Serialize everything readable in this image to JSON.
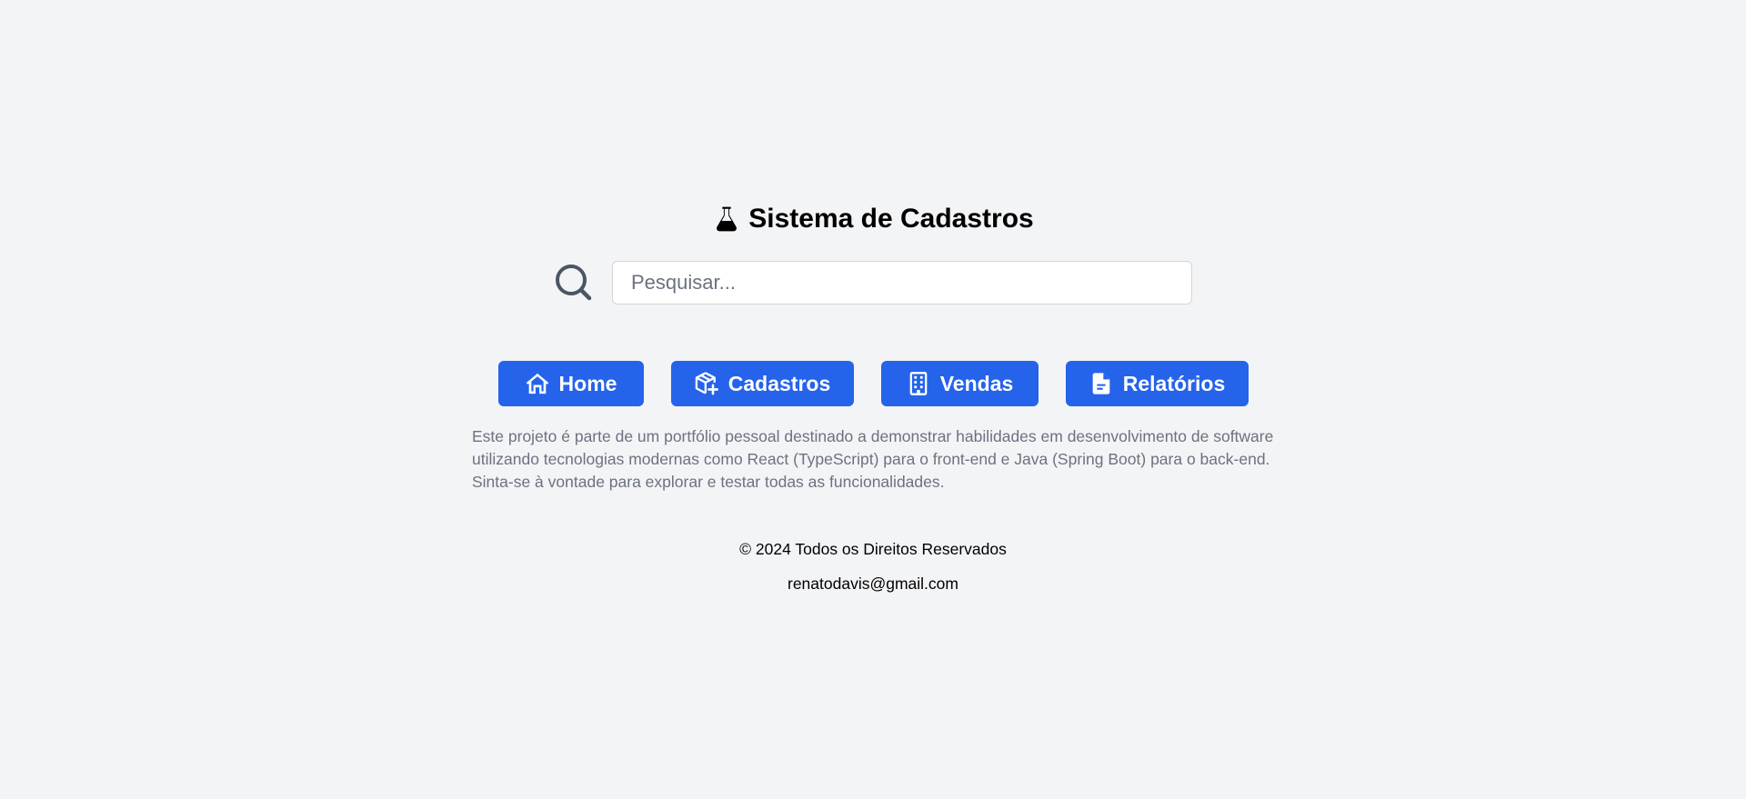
{
  "header": {
    "title": "Sistema de Cadastros",
    "icon": "flask-icon"
  },
  "search": {
    "icon": "search-icon",
    "placeholder": "Pesquisar...",
    "value": ""
  },
  "nav": {
    "home": {
      "label": "Home",
      "icon": "home-icon"
    },
    "cadastros": {
      "label": "Cadastros",
      "icon": "box-plus-icon"
    },
    "vendas": {
      "label": "Vendas",
      "icon": "building-icon"
    },
    "relatorios": {
      "label": "Relatórios",
      "icon": "document-icon"
    }
  },
  "description": {
    "line1": "Este projeto é parte de um portfólio pessoal destinado a demonstrar habilidades em desenvolvimento de software",
    "line2": "utilizando tecnologias modernas como React (TypeScript) para o front-end e Java (Spring Boot) para o back-end.",
    "line3": "Sinta-se à vontade para explorar e testar todas as funcionalidades."
  },
  "footer": {
    "copyright": "© 2024 Todos os Direitos Reservados",
    "email": "renatodavis@gmail.com"
  },
  "colors": {
    "background": "#f3f4f6",
    "primary": "#2563eb",
    "muted_text": "#6b7280"
  }
}
